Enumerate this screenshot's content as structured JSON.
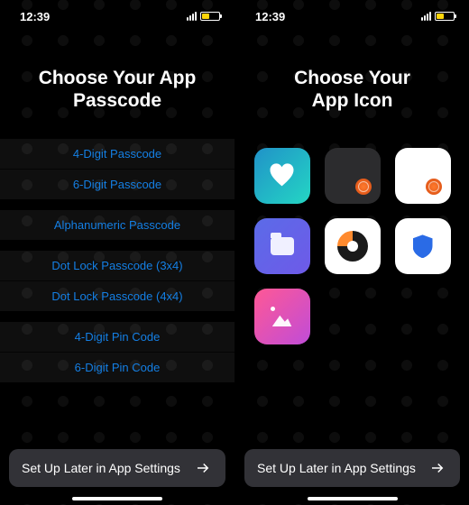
{
  "status": {
    "time": "12:39"
  },
  "left": {
    "title": "Choose Your App Passcode",
    "groups": [
      {
        "options": [
          "4-Digit Passcode",
          "6-Digit Passcode"
        ]
      },
      {
        "options": [
          "Alphanumeric Passcode"
        ]
      },
      {
        "options": [
          "Dot Lock Passcode (3x4)",
          "Dot Lock Passcode (4x4)"
        ]
      },
      {
        "options": [
          "4-Digit Pin Code",
          "6-Digit Pin Code"
        ]
      }
    ],
    "later_label": "Set Up Later in App Settings"
  },
  "right": {
    "title": "Choose Your\nApp Icon",
    "icons": [
      {
        "name": "heart-icon"
      },
      {
        "name": "dark-fingerprint-icon"
      },
      {
        "name": "white-fingerprint-icon"
      },
      {
        "name": "folder-icon"
      },
      {
        "name": "split-circle-icon"
      },
      {
        "name": "shield-icon"
      },
      {
        "name": "gallery-icon"
      }
    ],
    "later_label": "Set Up Later in App Settings"
  }
}
